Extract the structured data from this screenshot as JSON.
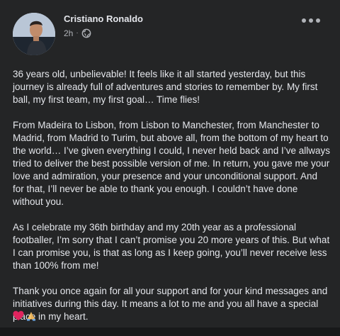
{
  "post": {
    "author": "Cristiano Ronaldo",
    "time": "2h",
    "separator": "·",
    "paragraphs": [
      "36 years old, unbelievable! It feels like it all started yesterday, but this journey is already full of adventures and stories to remember by. My first ball, my first team, my first goal… Time flies!",
      "From Madeira to Lisbon, from Lisbon to Manchester, from Manchester to Madrid, from Madrid to Turim, but above all, from the bottom of my heart to the world… I’ve given everything I could, I never held back and I’ve allways tried to deliver the best possible version of me. In return, you gave me your love and admiration, your presence and your unconditional support. And for that, I’ll never be able to thank you enough. I couldn’t have done without you.",
      "As I celebrate my 36th birthday and my 20th year as a professional footballer, I’m sorry that I can’t promise you 20 more years of this. But what I can promise you, is that as long as I keep going, you’ll never receive less than 100% from me!",
      "Thank you once again for all your support and for your kind messages and initiatives during this day. It means a lot to me and you all have a special place in my heart."
    ],
    "emoji_icons": [
      "red-heart-icon",
      "folded-hands-icon"
    ]
  },
  "colors": {
    "background": "#242526",
    "text": "#e4e6eb",
    "secondary_text": "#b0b3b8",
    "heart": "#e0245e",
    "hands": "#f5c36b"
  }
}
